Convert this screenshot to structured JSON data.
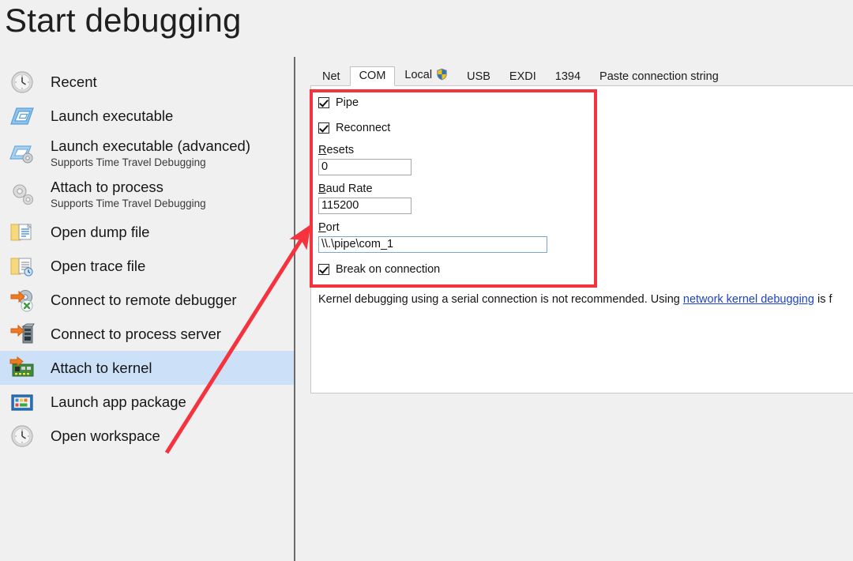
{
  "page": {
    "title": "Start debugging",
    "background": "#f0f0f0",
    "accent_selection": "#cce0f7",
    "annotation_color": "#f5333f"
  },
  "sidebar": {
    "items": [
      {
        "label": "Recent",
        "sub": "",
        "icon": "clock-icon",
        "selected": false
      },
      {
        "label": "Launch executable",
        "sub": "",
        "icon": "executable-icon",
        "selected": false
      },
      {
        "label": "Launch executable (advanced)",
        "sub": "Supports Time Travel Debugging",
        "icon": "executable-advanced-icon",
        "selected": false
      },
      {
        "label": "Attach to process",
        "sub": "Supports Time Travel Debugging",
        "icon": "gears-icon",
        "selected": false
      },
      {
        "label": "Open dump file",
        "sub": "",
        "icon": "folder-dump-icon",
        "selected": false
      },
      {
        "label": "Open trace file",
        "sub": "",
        "icon": "folder-trace-icon",
        "selected": false
      },
      {
        "label": "Connect to remote debugger",
        "sub": "",
        "icon": "remote-debugger-icon",
        "selected": false
      },
      {
        "label": "Connect to process server",
        "sub": "",
        "icon": "process-server-icon",
        "selected": false
      },
      {
        "label": "Attach to kernel",
        "sub": "",
        "icon": "kernel-card-icon",
        "selected": true
      },
      {
        "label": "Launch app package",
        "sub": "",
        "icon": "app-package-icon",
        "selected": false
      },
      {
        "label": "Open workspace",
        "sub": "",
        "icon": "clock-icon",
        "selected": false
      }
    ]
  },
  "tabs": {
    "items": [
      {
        "label": "Net",
        "active": false,
        "shield": false
      },
      {
        "label": "COM",
        "active": true,
        "shield": false
      },
      {
        "label": "Local",
        "active": false,
        "shield": true
      },
      {
        "label": "USB",
        "active": false,
        "shield": false
      },
      {
        "label": "EXDI",
        "active": false,
        "shield": false
      },
      {
        "label": "1394",
        "active": false,
        "shield": false
      },
      {
        "label": "Paste connection string",
        "active": false,
        "shield": false
      }
    ]
  },
  "form": {
    "pipe": {
      "label": "Pipe",
      "checked": true
    },
    "reconnect": {
      "label": "Reconnect",
      "checked": true
    },
    "resets": {
      "label_prefix": "",
      "label_accesskey": "R",
      "label_suffix": "esets",
      "value": "0"
    },
    "baud_rate": {
      "label_prefix": "",
      "label_accesskey": "B",
      "label_suffix": "aud Rate",
      "value": "115200"
    },
    "port": {
      "label_prefix": "",
      "label_accesskey": "P",
      "label_suffix": "ort",
      "value": "\\\\.\\pipe\\com_1"
    },
    "break_on_connection": {
      "label": "Break on connection",
      "checked": true
    }
  },
  "help": {
    "text_before": "Kernel debugging using a serial connection is not recommended. Using ",
    "link_text": "network kernel debugging",
    "text_after": " is f"
  }
}
